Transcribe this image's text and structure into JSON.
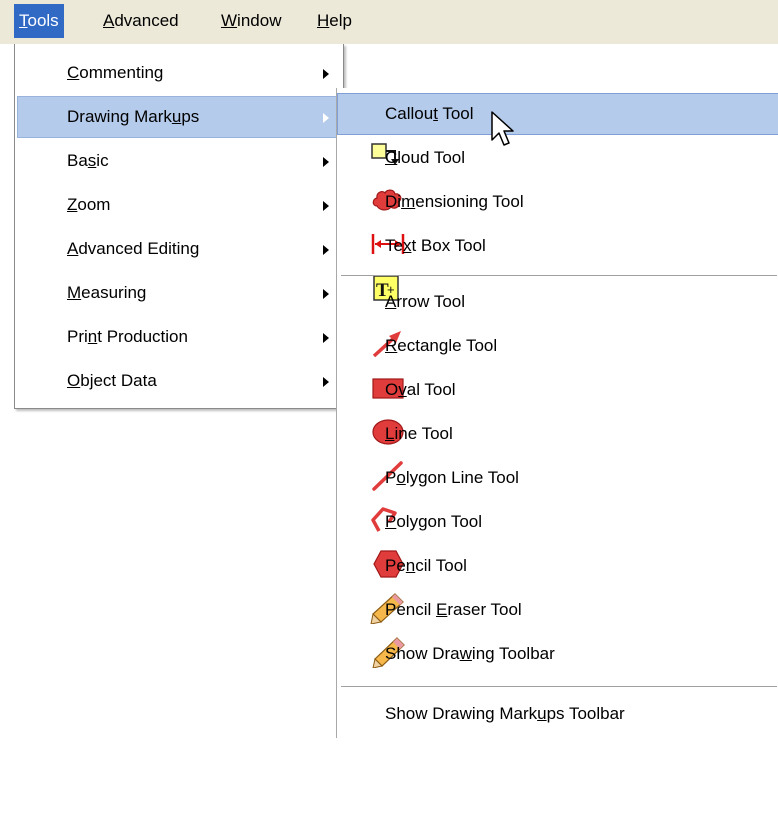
{
  "menubar": {
    "items": [
      {
        "prefix": "",
        "mnemonic": "T",
        "rest": "ools"
      },
      {
        "prefix": "",
        "mnemonic": "A",
        "rest": "dvanced"
      },
      {
        "prefix": "",
        "mnemonic": "W",
        "rest": "indow"
      },
      {
        "prefix": "",
        "mnemonic": "H",
        "rest": "elp"
      }
    ]
  },
  "tools_menu": {
    "items": [
      {
        "prefix": "",
        "mnemonic": "C",
        "rest": "ommenting"
      },
      {
        "prefix": "Drawing Mark",
        "mnemonic": "u",
        "rest": "ps"
      },
      {
        "prefix": "Ba",
        "mnemonic": "s",
        "rest": "ic"
      },
      {
        "prefix": "",
        "mnemonic": "Z",
        "rest": "oom"
      },
      {
        "prefix": "",
        "mnemonic": "A",
        "rest": "dvanced Editing"
      },
      {
        "prefix": "",
        "mnemonic": "M",
        "rest": "easuring"
      },
      {
        "prefix": "Pri",
        "mnemonic": "n",
        "rest": "t Production"
      },
      {
        "prefix": "",
        "mnemonic": "O",
        "rest": "bject Data"
      }
    ]
  },
  "drawing_markups_menu": {
    "items": [
      {
        "prefix": "Callou",
        "mnemonic": "t",
        "rest": " Tool",
        "icon": "callout-tool-icon"
      },
      {
        "prefix": "",
        "mnemonic": "C",
        "rest": "loud Tool",
        "icon": "cloud-tool-icon"
      },
      {
        "prefix": "Di",
        "mnemonic": "m",
        "rest": "ensioning Tool",
        "icon": "dimensioning-tool-icon"
      },
      {
        "prefix": "Te",
        "mnemonic": "x",
        "rest": "t Box Tool",
        "icon": "text-box-tool-icon"
      },
      {
        "prefix": "",
        "mnemonic": "A",
        "rest": "rrow Tool",
        "icon": "arrow-tool-icon"
      },
      {
        "prefix": "",
        "mnemonic": "R",
        "rest": "ectangle Tool",
        "icon": "rectangle-tool-icon"
      },
      {
        "prefix": "O",
        "mnemonic": "v",
        "rest": "al Tool",
        "icon": "oval-tool-icon"
      },
      {
        "prefix": "",
        "mnemonic": "L",
        "rest": "ine Tool",
        "icon": "line-tool-icon"
      },
      {
        "prefix": "P",
        "mnemonic": "o",
        "rest": "lygon Line Tool",
        "icon": "polygon-line-tool-icon"
      },
      {
        "prefix": "",
        "mnemonic": "P",
        "rest": "olygon Tool",
        "icon": "polygon-tool-icon"
      },
      {
        "prefix": "Pe",
        "mnemonic": "n",
        "rest": "cil Tool",
        "icon": "pencil-tool-icon"
      },
      {
        "prefix": "Pencil ",
        "mnemonic": "E",
        "rest": "raser Tool",
        "icon": "pencil-eraser-tool-icon"
      },
      {
        "prefix": "Show Dra",
        "mnemonic": "w",
        "rest": "ing Toolbar"
      },
      {
        "prefix": "Show Drawing Mark",
        "mnemonic": "u",
        "rest": "ps Toolbar"
      }
    ]
  },
  "colors": {
    "menubar_bg": "#ece9d8",
    "active_menu": "#316ac5",
    "highlight": "#b4cbeb",
    "icon_red": "#e03c3c",
    "icon_yellow": "#ffff99"
  }
}
